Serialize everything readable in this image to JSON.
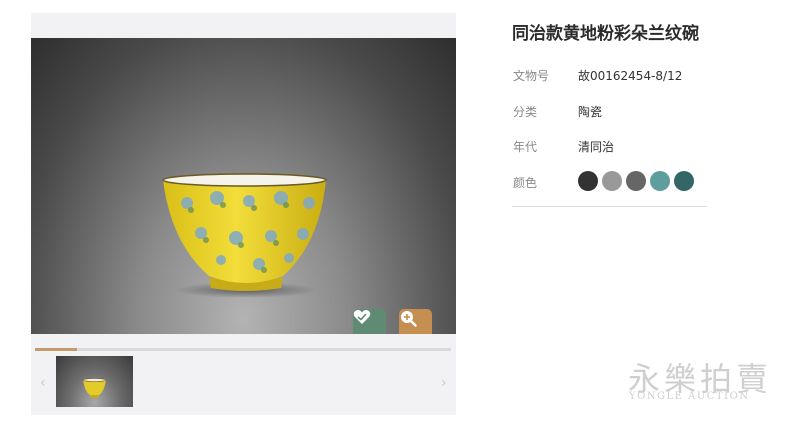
{
  "artifact": {
    "title": "同治款黄地粉彩朵兰纹碗",
    "fields": [
      {
        "label": "文物号",
        "value": "故00162454-8/12"
      },
      {
        "label": "分类",
        "value": "陶瓷"
      },
      {
        "label": "年代",
        "value": "清同治"
      },
      {
        "label": "颜色",
        "value": ""
      }
    ],
    "colors": [
      "#333333",
      "#999999",
      "#666666",
      "#5e9e9e",
      "#336666"
    ]
  },
  "gallery": {
    "progress": 0.1,
    "prev_arrow": "‹",
    "next_arrow": "›",
    "favorite_icon": "heart-icon",
    "zoom_icon": "zoom-in-icon"
  },
  "watermark": {
    "chinese": "永樂拍賣",
    "english": "YONGLE AUCTION"
  }
}
